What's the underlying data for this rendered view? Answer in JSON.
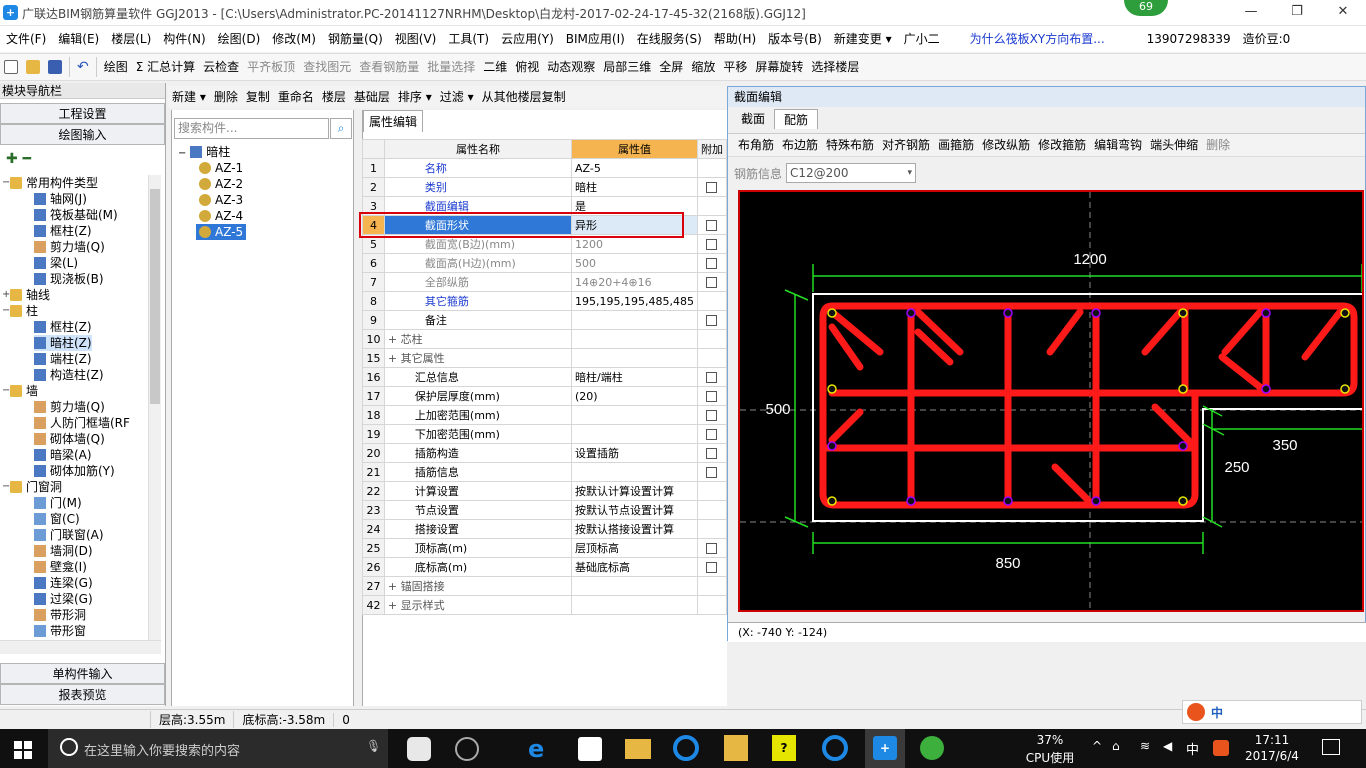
{
  "window": {
    "title": "广联达BIM钢筋算量软件 GGJ2013 - [C:\\Users\\Administrator.PC-20141127NRHM\\Desktop\\白龙村-2017-02-24-17-45-32(2168版).GGJ12]",
    "badge": "69"
  },
  "menu": [
    "文件(F)",
    "编辑(E)",
    "楼层(L)",
    "构件(N)",
    "绘图(D)",
    "修改(M)",
    "钢筋量(Q)",
    "视图(V)",
    "工具(T)",
    "云应用(Y)",
    "BIM应用(I)",
    "在线服务(S)",
    "帮助(H)",
    "版本号(B)",
    "新建变更 ▾",
    "广小二"
  ],
  "menu_right": {
    "notice": "为什么筏板XY方向布置...",
    "phone": "13907298339",
    "cost": "造价豆:0"
  },
  "toolbar1": [
    "绘图",
    "Σ 汇总计算",
    "云检查",
    "平齐板顶",
    "查找图元",
    "查看钢筋量",
    "批量选择",
    "二维",
    "俯视",
    "动态观察",
    "局部三维",
    "全屏",
    "缩放",
    "平移",
    "屏幕旋转",
    "选择楼层"
  ],
  "nav": {
    "title": "模块导航栏",
    "btn1": "工程设置",
    "btn2": "绘图输入",
    "btn3": "单构件输入",
    "btn4": "报表预览",
    "tree": [
      {
        "label": "常用构件类型",
        "level": 0,
        "icon": "fold",
        "exp": "−"
      },
      {
        "label": "轴网(J)",
        "level": 1,
        "icon": "col"
      },
      {
        "label": "筏板基础(M)",
        "level": 1,
        "icon": "col"
      },
      {
        "label": "框柱(Z)",
        "level": 1,
        "icon": "col"
      },
      {
        "label": "剪力墙(Q)",
        "level": 1,
        "icon": "wall"
      },
      {
        "label": "梁(L)",
        "level": 1,
        "icon": "col"
      },
      {
        "label": "现浇板(B)",
        "level": 1,
        "icon": "col"
      },
      {
        "label": "轴线",
        "level": 0,
        "icon": "fold",
        "exp": "+"
      },
      {
        "label": "柱",
        "level": 0,
        "icon": "fold",
        "exp": "−"
      },
      {
        "label": "框柱(Z)",
        "level": 1,
        "icon": "col"
      },
      {
        "label": "暗柱(Z)",
        "level": 1,
        "icon": "col"
      },
      {
        "label": "端柱(Z)",
        "level": 1,
        "icon": "col"
      },
      {
        "label": "构造柱(Z)",
        "level": 1,
        "icon": "col"
      },
      {
        "label": "墙",
        "level": 0,
        "icon": "fold",
        "exp": "−"
      },
      {
        "label": "剪力墙(Q)",
        "level": 1,
        "icon": "wall"
      },
      {
        "label": "人防门框墙(RF",
        "level": 1,
        "icon": "wall"
      },
      {
        "label": "砌体墙(Q)",
        "level": 1,
        "icon": "wall"
      },
      {
        "label": "暗梁(A)",
        "level": 1,
        "icon": "col"
      },
      {
        "label": "砌体加筋(Y)",
        "level": 1,
        "icon": "col"
      },
      {
        "label": "门窗洞",
        "level": 0,
        "icon": "fold",
        "exp": "−"
      },
      {
        "label": "门(M)",
        "level": 1,
        "icon": "door"
      },
      {
        "label": "窗(C)",
        "level": 1,
        "icon": "door"
      },
      {
        "label": "门联窗(A)",
        "level": 1,
        "icon": "door"
      },
      {
        "label": "墙洞(D)",
        "level": 1,
        "icon": "wall"
      },
      {
        "label": "壁龛(I)",
        "level": 1,
        "icon": "wall"
      },
      {
        "label": "连梁(G)",
        "level": 1,
        "icon": "col"
      },
      {
        "label": "过梁(G)",
        "level": 1,
        "icon": "col"
      },
      {
        "label": "带形洞",
        "level": 1,
        "icon": "wall"
      },
      {
        "label": "带形窗",
        "level": 1,
        "icon": "door"
      }
    ]
  },
  "comp_toolbar": [
    "新建 ▾",
    "删除",
    "复制",
    "重命名",
    "楼层",
    "基础层",
    "排序 ▾",
    "过滤 ▾",
    "从其他楼层复制"
  ],
  "search_placeholder": "搜索构件...",
  "components": {
    "root": "暗柱",
    "items": [
      "AZ-1",
      "AZ-2",
      "AZ-3",
      "AZ-4",
      "AZ-5"
    ],
    "selected": "AZ-5"
  },
  "props": {
    "tab": "属性编辑",
    "h_name": "属性名称",
    "h_value": "属性值",
    "h_add": "附加",
    "rows": [
      {
        "n": "1",
        "name": "名称",
        "value": "AZ-5",
        "style": "blue",
        "chk": false
      },
      {
        "n": "2",
        "name": "类别",
        "value": "暗柱",
        "style": "blue",
        "chk": true
      },
      {
        "n": "3",
        "name": "截面编辑",
        "value": "是",
        "style": "blue",
        "chk": false
      },
      {
        "n": "4",
        "name": "截面形状",
        "value": "异形",
        "style": "sel",
        "chk": true
      },
      {
        "n": "5",
        "name": "截面宽(B边)(mm)",
        "value": "1200",
        "style": "gray",
        "chk": true
      },
      {
        "n": "6",
        "name": "截面高(H边)(mm)",
        "value": "500",
        "style": "gray",
        "chk": true
      },
      {
        "n": "7",
        "name": "全部纵筋",
        "value": "14⊕20+4⊕16",
        "style": "gray",
        "chk": true
      },
      {
        "n": "8",
        "name": "其它箍筋",
        "value": "195,195,195,485,485",
        "style": "blue",
        "chk": false
      },
      {
        "n": "9",
        "name": "备注",
        "value": "",
        "style": "",
        "chk": true
      },
      {
        "n": "10",
        "name": "芯柱",
        "value": "",
        "style": "grp",
        "chk": false
      },
      {
        "n": "15",
        "name": "其它属性",
        "value": "",
        "style": "grp",
        "chk": false
      },
      {
        "n": "16",
        "name": "汇总信息",
        "value": "暗柱/端柱",
        "style": "sub",
        "chk": true
      },
      {
        "n": "17",
        "name": "保护层厚度(mm)",
        "value": "(20)",
        "style": "sub",
        "chk": true
      },
      {
        "n": "18",
        "name": "上加密范围(mm)",
        "value": "",
        "style": "sub",
        "chk": true
      },
      {
        "n": "19",
        "name": "下加密范围(mm)",
        "value": "",
        "style": "sub",
        "chk": true
      },
      {
        "n": "20",
        "name": "插筋构造",
        "value": "设置插筋",
        "style": "sub",
        "chk": true
      },
      {
        "n": "21",
        "name": "插筋信息",
        "value": "",
        "style": "sub",
        "chk": true
      },
      {
        "n": "22",
        "name": "计算设置",
        "value": "按默认计算设置计算",
        "style": "sub",
        "chk": false
      },
      {
        "n": "23",
        "name": "节点设置",
        "value": "按默认节点设置计算",
        "style": "sub",
        "chk": false
      },
      {
        "n": "24",
        "name": "搭接设置",
        "value": "按默认搭接设置计算",
        "style": "sub",
        "chk": false
      },
      {
        "n": "25",
        "name": "顶标高(m)",
        "value": "层顶标高",
        "style": "sub",
        "chk": true
      },
      {
        "n": "26",
        "name": "底标高(m)",
        "value": "基础底标高",
        "style": "sub",
        "chk": true
      },
      {
        "n": "27",
        "name": "锚固搭接",
        "value": "",
        "style": "grp",
        "chk": false
      },
      {
        "n": "42",
        "name": "显示样式",
        "value": "",
        "style": "grp",
        "chk": false
      }
    ]
  },
  "section": {
    "title": "截面编辑",
    "tabs": [
      "截面",
      "配筋"
    ],
    "active_tab": "配筋",
    "tools": [
      "布角筋",
      "布边筋",
      "特殊布筋",
      "对齐钢筋",
      "画箍筋",
      "修改纵筋",
      "修改箍筋",
      "编辑弯钩",
      "端头伸缩",
      "删除"
    ],
    "rebar_label": "钢筋信息",
    "rebar_value": "C12@200",
    "dims": {
      "top": "1200",
      "left": "500",
      "right": "350",
      "notch": "250",
      "bottom": "850"
    },
    "coord": "(X: -740 Y: -124)"
  },
  "status": {
    "floor_h": "层高:3.55m",
    "base_h": "底标高:-3.58m",
    "val": "0"
  },
  "taskbar": {
    "search": "在这里输入你要搜索的内容",
    "cpu": "37%",
    "cpu_label": "CPU使用",
    "ime": "中",
    "time": "17:11",
    "date": "2017/6/4"
  },
  "colors": {
    "accent": "#1e88e5",
    "rebar": "#ff1a1a",
    "dim": "#22dd22",
    "highlight": "#d9000b"
  }
}
